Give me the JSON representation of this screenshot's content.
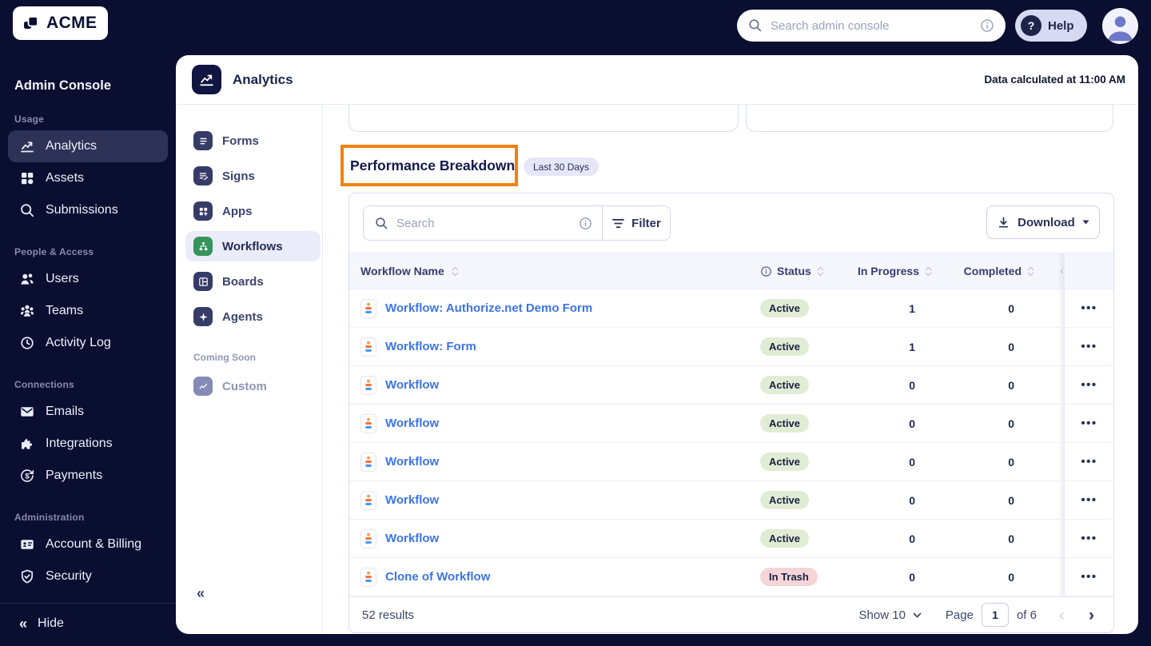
{
  "colors": {
    "navy": "#0a0e31",
    "accent_orange": "#f0820f",
    "link_blue": "#3b74e9",
    "active_badge": "#e1ecd4",
    "trash_badge": "#f6d5d8",
    "workflows_green": "#35935c",
    "selected_sidebar": "#2e3257",
    "selected_nav": "#ebecfa"
  },
  "icons": {
    "help_glyph": "?",
    "ellipsis": "•••",
    "collapse": "«",
    "prev": "‹",
    "next": "›"
  },
  "topbar": {
    "logo_text": "ACME",
    "search_placeholder": "Search admin console",
    "help_label": "Help"
  },
  "sidebar": {
    "title": "Admin Console",
    "sections": [
      {
        "label": "Usage",
        "items": [
          {
            "label": "Analytics"
          },
          {
            "label": "Assets"
          },
          {
            "label": "Submissions"
          }
        ]
      },
      {
        "label": "People & Access",
        "items": [
          {
            "label": "Users"
          },
          {
            "label": "Teams"
          },
          {
            "label": "Activity Log"
          }
        ]
      },
      {
        "label": "Connections",
        "items": [
          {
            "label": "Emails"
          },
          {
            "label": "Integrations"
          },
          {
            "label": "Payments"
          }
        ]
      },
      {
        "label": "Administration",
        "items": [
          {
            "label": "Account & Billing"
          },
          {
            "label": "Security"
          }
        ]
      }
    ],
    "hide_label": "Hide"
  },
  "panel": {
    "title": "Analytics",
    "data_note": "Data calculated at 11:00 AM",
    "nav": {
      "items": [
        {
          "label": "Forms"
        },
        {
          "label": "Signs"
        },
        {
          "label": "Apps"
        },
        {
          "label": "Workflows"
        },
        {
          "label": "Boards"
        },
        {
          "label": "Agents"
        }
      ],
      "coming_soon_label": "Coming Soon",
      "coming_soon_items": [
        {
          "label": "Custom"
        }
      ]
    },
    "section": {
      "heading": "Performance Breakdown",
      "badge": "Last 30 Days"
    }
  },
  "table": {
    "search_placeholder": "Search",
    "filter_label": "Filter",
    "download_label": "Download",
    "columns": [
      "Workflow Name",
      "Status",
      "In Progress",
      "Completed"
    ],
    "rows": [
      {
        "name": "Workflow: Authorize.net Demo Form",
        "status": "Active",
        "status_type": "active",
        "in_progress": "1",
        "completed": "0"
      },
      {
        "name": "Workflow: Form",
        "status": "Active",
        "status_type": "active",
        "in_progress": "1",
        "completed": "0"
      },
      {
        "name": "Workflow",
        "status": "Active",
        "status_type": "active",
        "in_progress": "0",
        "completed": "0"
      },
      {
        "name": "Workflow",
        "status": "Active",
        "status_type": "active",
        "in_progress": "0",
        "completed": "0"
      },
      {
        "name": "Workflow",
        "status": "Active",
        "status_type": "active",
        "in_progress": "0",
        "completed": "0"
      },
      {
        "name": "Workflow",
        "status": "Active",
        "status_type": "active",
        "in_progress": "0",
        "completed": "0"
      },
      {
        "name": "Workflow",
        "status": "Active",
        "status_type": "active",
        "in_progress": "0",
        "completed": "0"
      },
      {
        "name": "Clone of Workflow",
        "status": "In Trash",
        "status_type": "trash",
        "in_progress": "0",
        "completed": "0"
      }
    ],
    "footer": {
      "results": "52 results",
      "show_label": "Show 10",
      "page_label": "Page",
      "page_value": "1",
      "of_label": "of 6"
    }
  }
}
